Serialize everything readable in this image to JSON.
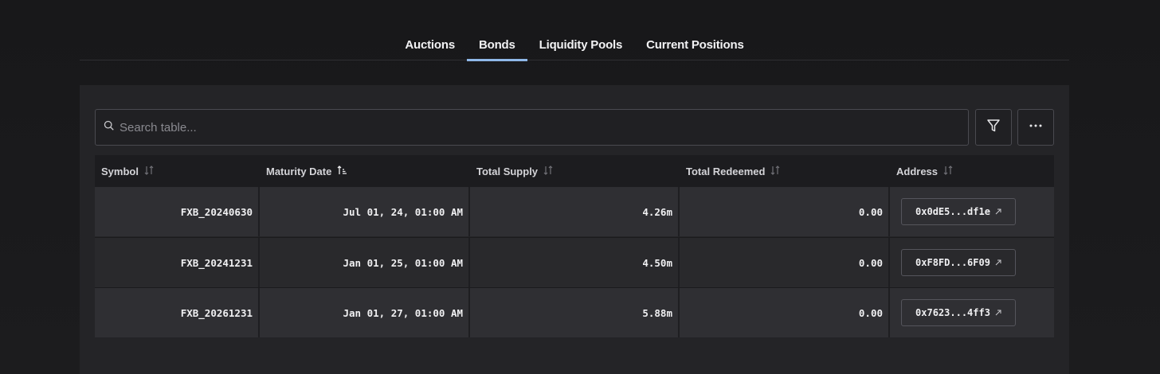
{
  "tabs": [
    {
      "label": "Auctions",
      "active": false
    },
    {
      "label": "Bonds",
      "active": true
    },
    {
      "label": "Liquidity Pools",
      "active": false
    },
    {
      "label": "Current Positions",
      "active": false
    }
  ],
  "search": {
    "placeholder": "Search table..."
  },
  "toolbar": {
    "filter_icon": "filter-icon",
    "more_icon": "more-horizontal-icon"
  },
  "table": {
    "columns": [
      {
        "label": "Symbol",
        "sort_icon": "sort-icon"
      },
      {
        "label": "Maturity Date",
        "sort_icon": "sort-ascending-icon"
      },
      {
        "label": "Total Supply",
        "sort_icon": "sort-icon"
      },
      {
        "label": "Total Redeemed",
        "sort_icon": "sort-icon"
      },
      {
        "label": "Address",
        "sort_icon": "sort-icon"
      }
    ],
    "rows": [
      {
        "symbol": "FXB_20240630",
        "maturity": "Jul 01, 24, 01:00 AM",
        "supply": "4.26m",
        "redeemed": "0.00",
        "address": "0x0dE5...df1e"
      },
      {
        "symbol": "FXB_20241231",
        "maturity": "Jan 01, 25, 01:00 AM",
        "supply": "4.50m",
        "redeemed": "0.00",
        "address": "0xF8FD...6F09"
      },
      {
        "symbol": "FXB_20261231",
        "maturity": "Jan 01, 27, 01:00 AM",
        "supply": "5.88m",
        "redeemed": "0.00",
        "address": "0x7623...4ff3"
      }
    ]
  },
  "colors": {
    "accent": "#8fb8e8",
    "background": "#1c1c1e",
    "panel": "#242427"
  }
}
